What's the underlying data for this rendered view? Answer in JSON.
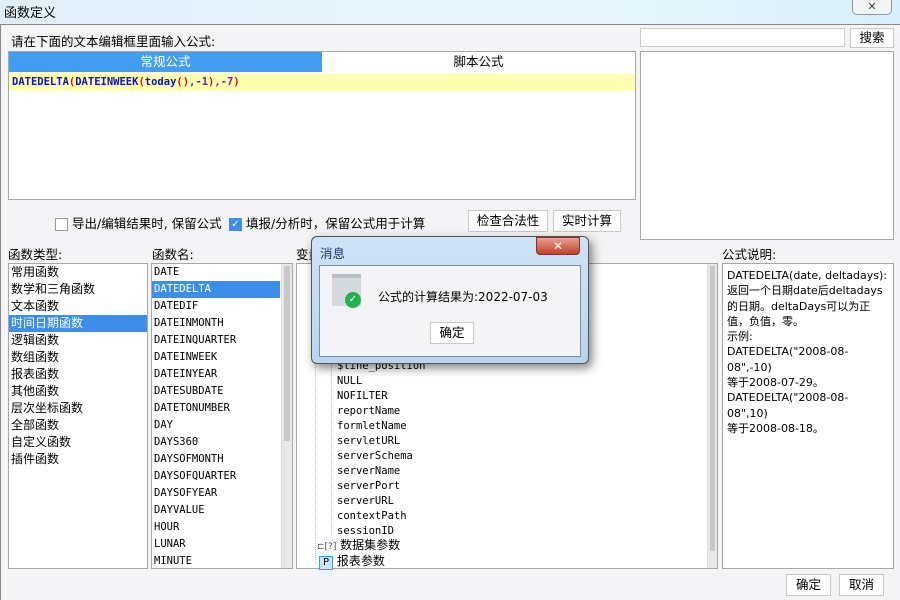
{
  "window": {
    "title": "函数定义"
  },
  "editor": {
    "prompt": "请在下面的文本编辑框里面输入公式:",
    "tabs": [
      {
        "label": "常规公式",
        "active": true
      },
      {
        "label": "脚本公式",
        "active": false
      }
    ],
    "formula_tokens": [
      {
        "t": "DATEDELTA",
        "c": "#1010c8"
      },
      {
        "t": "(",
        "c": "#e01010"
      },
      {
        "t": "DATEINWEEK",
        "c": "#1010c8"
      },
      {
        "t": "(",
        "c": "#e01010"
      },
      {
        "t": "today",
        "c": "#1010c8"
      },
      {
        "t": "()",
        "c": "#e01010"
      },
      {
        "t": ",-1",
        "c": "#8020a0"
      },
      {
        "t": ")",
        "c": "#e01010"
      },
      {
        "t": ",-7",
        "c": "#8020a0"
      },
      {
        "t": ")",
        "c": "#e01010"
      }
    ]
  },
  "search": {
    "value": "",
    "button": "搜索"
  },
  "options": {
    "export_keep": {
      "label": "导出/编辑结果时, 保留公式",
      "checked": false
    },
    "fill_keep": {
      "label": "填报/分析时，保留公式用于计算",
      "checked": true
    },
    "check_button": "检查合法性",
    "realtime_button": "实时计算"
  },
  "func_types": {
    "label": "函数类型:",
    "items": [
      "常用函数",
      "数学和三角函数",
      "文本函数",
      "时间日期函数",
      "逻辑函数",
      "数组函数",
      "报表函数",
      "其他函数",
      "层次坐标函数",
      "全部函数",
      "自定义函数",
      "插件函数"
    ],
    "selected": 3
  },
  "func_names": {
    "label": "函数名:",
    "items": [
      "DATE",
      "DATEDELTA",
      "DATEDIF",
      "DATEINMONTH",
      "DATEINQUARTER",
      "DATEINWEEK",
      "DATEINYEAR",
      "DATESUBDATE",
      "DATETONUMBER",
      "DAY",
      "DAYS360",
      "DAYSOFMONTH",
      "DAYSOFQUARTER",
      "DAYSOFYEAR",
      "DAYVALUE",
      "HOUR",
      "LUNAR",
      "MINUTE"
    ],
    "selected": 1
  },
  "variables": {
    "label": "变量:",
    "items": [
      "$line_position",
      "NULL",
      "NOFILTER",
      "reportName",
      "formletName",
      "servletURL",
      "serverSchema",
      "serverName",
      "serverPort",
      "serverURL",
      "contextPath",
      "sessionID"
    ],
    "groups": [
      "数据集参数",
      "报表参数"
    ]
  },
  "description": {
    "label": "公式说明:",
    "lines": [
      "DATEDELTA(date, deltadays):",
      "返回一个日期date后deltadays",
      "的日期。deltaDays可以为正",
      "值，负值，零。",
      "示例:",
      "DATEDELTA(\"2008-08-08\",-10)",
      "等于2008-07-29。",
      "DATEDELTA(\"2008-08-08\",10)",
      "等于2008-08-18。"
    ]
  },
  "footer": {
    "ok": "确定",
    "cancel": "取消"
  },
  "dialog": {
    "title": "消息",
    "message": "公式的计算结果为:2022-07-03",
    "ok": "确定"
  }
}
